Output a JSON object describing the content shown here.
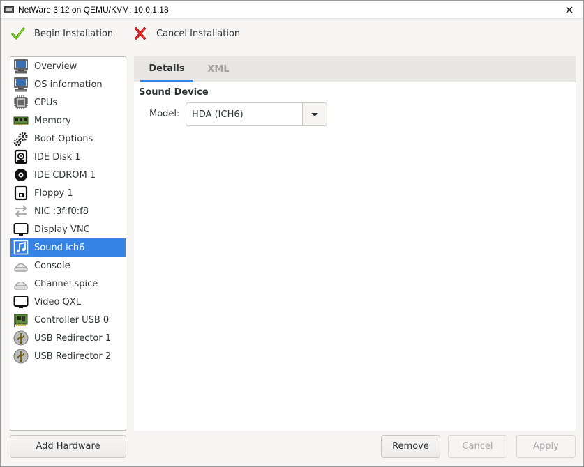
{
  "window": {
    "title": "NetWare 3.12 on QEMU/KVM: 10.0.1.18",
    "close_glyph": "✕"
  },
  "toolbar": {
    "begin_label": "Begin Installation",
    "cancel_label": "Cancel Installation"
  },
  "sidebar": {
    "items": [
      {
        "label": "Overview",
        "icon": "monitor-icon"
      },
      {
        "label": "OS information",
        "icon": "monitor-icon"
      },
      {
        "label": "CPUs",
        "icon": "cpu-icon"
      },
      {
        "label": "Memory",
        "icon": "memory-icon"
      },
      {
        "label": "Boot Options",
        "icon": "gears-icon"
      },
      {
        "label": "IDE Disk 1",
        "icon": "disk-icon"
      },
      {
        "label": "IDE CDROM 1",
        "icon": "cdrom-icon"
      },
      {
        "label": "Floppy 1",
        "icon": "floppy-icon"
      },
      {
        "label": "NIC :3f:f0:f8",
        "icon": "network-arrows-icon"
      },
      {
        "label": "Display VNC",
        "icon": "display-icon"
      },
      {
        "label": "Sound ich6",
        "icon": "sound-icon",
        "selected": true
      },
      {
        "label": "Console",
        "icon": "serial-icon"
      },
      {
        "label": "Channel spice",
        "icon": "serial-icon"
      },
      {
        "label": "Video QXL",
        "icon": "display-icon"
      },
      {
        "label": "Controller USB 0",
        "icon": "controller-card-icon"
      },
      {
        "label": "USB Redirector 1",
        "icon": "usb-icon"
      },
      {
        "label": "USB Redirector 2",
        "icon": "usb-icon"
      }
    ]
  },
  "tabs": {
    "details": "Details",
    "xml": "XML"
  },
  "details": {
    "section_title": "Sound Device",
    "model_label": "Model:",
    "model_value": "HDA (ICH6)"
  },
  "buttons": {
    "add_hardware": "Add Hardware",
    "remove": "Remove",
    "cancel": "Cancel",
    "apply": "Apply"
  },
  "colors": {
    "accent": "#3584e4",
    "selected_bg": "#3584e4"
  }
}
